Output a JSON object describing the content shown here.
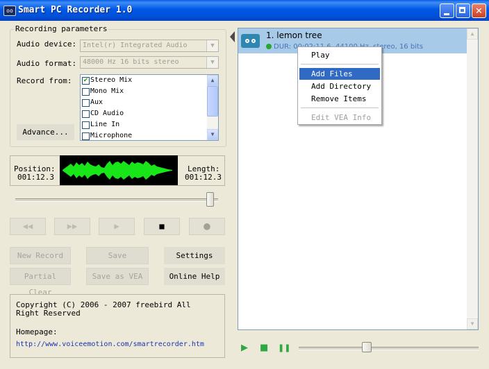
{
  "window": {
    "title": "Smart PC Recorder 1.0",
    "icon_text": "oo",
    "controls": {
      "minimize": "minimize-icon",
      "maximize": "maximize-icon",
      "close_glyph": "✕"
    },
    "accent": "#0058e6",
    "close_color": "#c9401f"
  },
  "recording": {
    "group_title": "Recording parameters",
    "audio_device_label": "Audio device:",
    "audio_device_value": "Intel(r) Integrated Audio",
    "audio_format_label": "Audio format:",
    "audio_format_value": "48000 Hz 16 bits stereo",
    "record_from_label": "Record from:",
    "sources": [
      {
        "label": "Stereo Mix",
        "checked": true
      },
      {
        "label": "Mono Mix",
        "checked": false
      },
      {
        "label": "Aux",
        "checked": false
      },
      {
        "label": "CD Audio",
        "checked": false
      },
      {
        "label": "Line In",
        "checked": false
      },
      {
        "label": "Microphone",
        "checked": false
      }
    ],
    "advance_button": "Advance..."
  },
  "meters": {
    "position_label": "Position:",
    "position_value": "001:12.3",
    "length_label": "Length:",
    "length_value": "001:12.3",
    "waveform_color": "#19e619"
  },
  "seek_slider_position_fraction": 0.98,
  "transport": {
    "rewind": "◀◀",
    "forward": "▶▶",
    "play": "▶",
    "stop": "■",
    "record": "●"
  },
  "buttons": {
    "new_record": "New Record",
    "save": "Save",
    "settings": "Settings",
    "partial_clear": "Partial Clear",
    "save_as_vea": "Save as VEA",
    "online_help": "Online Help"
  },
  "about": {
    "copyright": "Copyright (C) 2006 - 2007  freebird All Right Reserved",
    "homepage_label": "Homepage:",
    "homepage_url": "http://www.voiceemotion.com/smartrecorder.htm"
  },
  "playlist": {
    "tracks": [
      {
        "title": "1. lemon tree",
        "info": "DUR: 00:02:11.6, 44100 Hz, stereo, 16 bits"
      }
    ],
    "selection_color": "#a6cae8"
  },
  "context_menu": {
    "items": [
      {
        "label": "Play",
        "state": "normal"
      },
      {
        "label": "Add Files",
        "state": "highlighted"
      },
      {
        "label": "Add Directory",
        "state": "normal"
      },
      {
        "label": "Remove Items",
        "state": "normal"
      },
      {
        "label": "Edit VEA Info",
        "state": "disabled"
      }
    ]
  },
  "player_bar": {
    "play": "▶",
    "stop": "■",
    "pause": "❚❚",
    "volume_position_fraction": 0.37,
    "icon_color": "#2ea843"
  }
}
